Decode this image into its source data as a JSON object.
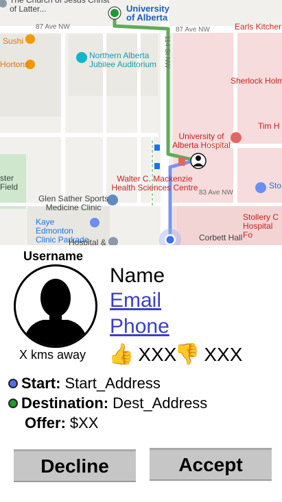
{
  "map": {
    "pois": {
      "church": "The Church of Jesus Christ of Latter...",
      "university": "University of Alberta",
      "sushi": "Sushi",
      "hortons": "Hortons",
      "auditorium": "Northern Alberta Jubilee Auditorium",
      "earls": "Earls Kitcher",
      "sherlock": "Sherlock Holm",
      "tim": "Tim H",
      "hospital": "University of Alberta Hospital",
      "mackenzie": "Walter C. Mackenzie Health Sciences Centre",
      "sather": "Glen Sather Sports Medicine Clinic",
      "kaye": "Kaye Edmonton Clinic Parkade",
      "stollery": "Stollery C Hospital Fo",
      "corbett": "Corbett Hall",
      "hospital_bottom": "Hospital &",
      "field": "ster Field",
      "sto": "Sto"
    },
    "roads": {
      "ave87_left": "87 Ave NW",
      "ave87_right": "87 Ave NW",
      "st114": "114 St NW",
      "ave83": "83 Ave NW"
    }
  },
  "profile": {
    "username": "Username",
    "distance": "X kms away",
    "name": "Name",
    "email": "Email",
    "phone": "Phone",
    "likes_icon": "👍",
    "likes": "XXX",
    "dislikes_icon": "👎",
    "dislikes": "XXX"
  },
  "trip": {
    "start_label": "Start:",
    "start_value": "Start_Address",
    "destination_label": "Destination:",
    "destination_value": "Dest_Address",
    "offer_label": "Offer:",
    "offer_value": "$XX"
  },
  "actions": {
    "decline": "Decline",
    "accept": "Accept"
  },
  "colors": {
    "link": "#3b3fc4",
    "route_green": "#5fab5a",
    "route_blue": "#7b93f0",
    "start_dot": "#4f6fe8",
    "destination_dot": "#1e9b2e",
    "button": "#c6c6c6"
  }
}
